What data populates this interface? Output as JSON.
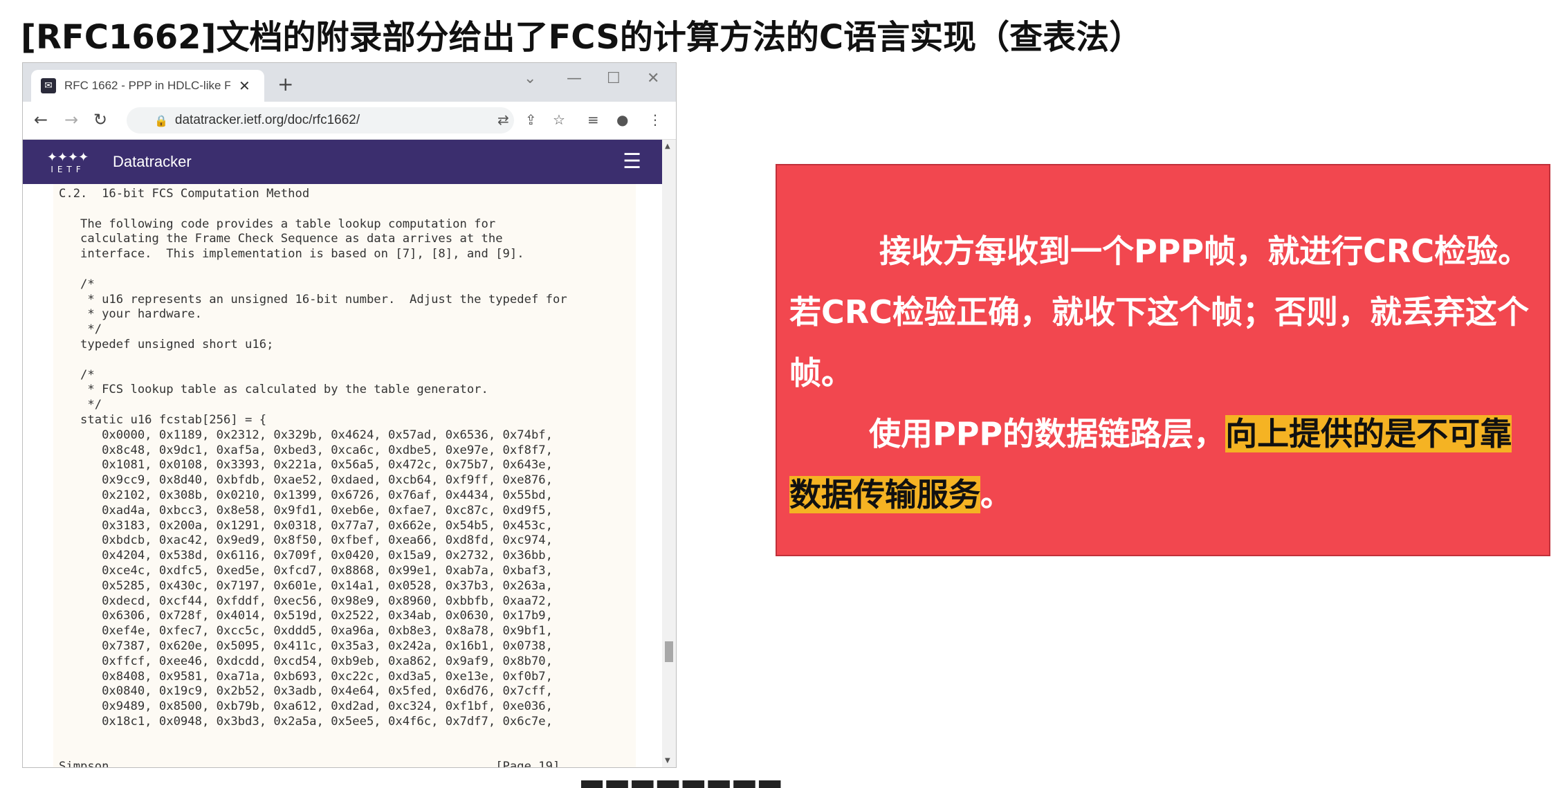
{
  "slide": {
    "title": "[RFC1662]文档的附录部分给出了FCS的计算方法的C语言实现（查表法）",
    "bottom_text": "▇▇▇▇▇▇▇▇"
  },
  "browser": {
    "tab_title": "RFC 1662 - PPP in HDLC-like F",
    "tab_close": "✕",
    "new_tab": "+",
    "url": "datatracker.ietf.org/doc/rfc1662/",
    "site_name": "Datatracker",
    "logo_text": "IETF",
    "code_text": "C.2.  16-bit FCS Computation Method\n\n   The following code provides a table lookup computation for\n   calculating the Frame Check Sequence as data arrives at the\n   interface.  This implementation is based on [7], [8], and [9].\n\n   /*\n    * u16 represents an unsigned 16-bit number.  Adjust the typedef for\n    * your hardware.\n    */\n   typedef unsigned short u16;\n\n   /*\n    * FCS lookup table as calculated by the table generator.\n    */\n   static u16 fcstab[256] = {\n      0x0000, 0x1189, 0x2312, 0x329b, 0x4624, 0x57ad, 0x6536, 0x74bf,\n      0x8c48, 0x9dc1, 0xaf5a, 0xbed3, 0xca6c, 0xdbe5, 0xe97e, 0xf8f7,\n      0x1081, 0x0108, 0x3393, 0x221a, 0x56a5, 0x472c, 0x75b7, 0x643e,\n      0x9cc9, 0x8d40, 0xbfdb, 0xae52, 0xdaed, 0xcb64, 0xf9ff, 0xe876,\n      0x2102, 0x308b, 0x0210, 0x1399, 0x6726, 0x76af, 0x4434, 0x55bd,\n      0xad4a, 0xbcc3, 0x8e58, 0x9fd1, 0xeb6e, 0xfae7, 0xc87c, 0xd9f5,\n      0x3183, 0x200a, 0x1291, 0x0318, 0x77a7, 0x662e, 0x54b5, 0x453c,\n      0xbdcb, 0xac42, 0x9ed9, 0x8f50, 0xfbef, 0xea66, 0xd8fd, 0xc974,\n      0x4204, 0x538d, 0x6116, 0x709f, 0x0420, 0x15a9, 0x2732, 0x36bb,\n      0xce4c, 0xdfc5, 0xed5e, 0xfcd7, 0x8868, 0x99e1, 0xab7a, 0xbaf3,\n      0x5285, 0x430c, 0x7197, 0x601e, 0x14a1, 0x0528, 0x37b3, 0x263a,\n      0xdecd, 0xcf44, 0xfddf, 0xec56, 0x98e9, 0x8960, 0xbbfb, 0xaa72,\n      0x6306, 0x728f, 0x4014, 0x519d, 0x2522, 0x34ab, 0x0630, 0x17b9,\n      0xef4e, 0xfec7, 0xcc5c, 0xddd5, 0xa96a, 0xb8e3, 0x8a78, 0x9bf1,\n      0x7387, 0x620e, 0x5095, 0x411c, 0x35a3, 0x242a, 0x16b1, 0x0738,\n      0xffcf, 0xee46, 0xdcdd, 0xcd54, 0xb9eb, 0xa862, 0x9af9, 0x8b70,\n      0x8408, 0x9581, 0xa71a, 0xb693, 0xc22c, 0xd3a5, 0xe13e, 0xf0b7,\n      0x0840, 0x19c9, 0x2b52, 0x3adb, 0x4e64, 0x5fed, 0x6d76, 0x7cff,\n      0x9489, 0x8500, 0xb79b, 0xa612, 0xd2ad, 0xc324, 0xf1bf, 0xe036,\n      0x18c1, 0x0948, 0x3bd3, 0x2a5a, 0x5ee5, 0x4f6c, 0x7df7, 0x6c7e,\n\n\nSimpson                                                      [Page 19]"
  },
  "panel": {
    "p1": "接收方每收到一个PPP帧，就进行CRC检验。若CRC检验正确，就收下这个帧；否则，就丢弃这个帧。",
    "p2_normal": "使用PPP的数据链路层，",
    "p2_highlight": "向上提供的是不可靠数据传输服务",
    "p2_end": "。",
    "colors": {
      "background": "#f2474f",
      "highlight": "#f5b323"
    }
  },
  "icons": {
    "back": "back-arrow-icon",
    "forward": "forward-arrow-icon",
    "reload": "reload-icon",
    "lock": "lock-icon",
    "translate": "translate-icon",
    "share": "share-icon",
    "star": "star-icon",
    "reading-list": "reading-list-icon",
    "profile": "profile-icon",
    "menu": "kebab-menu-icon",
    "hamburger": "hamburger-menu-icon"
  }
}
